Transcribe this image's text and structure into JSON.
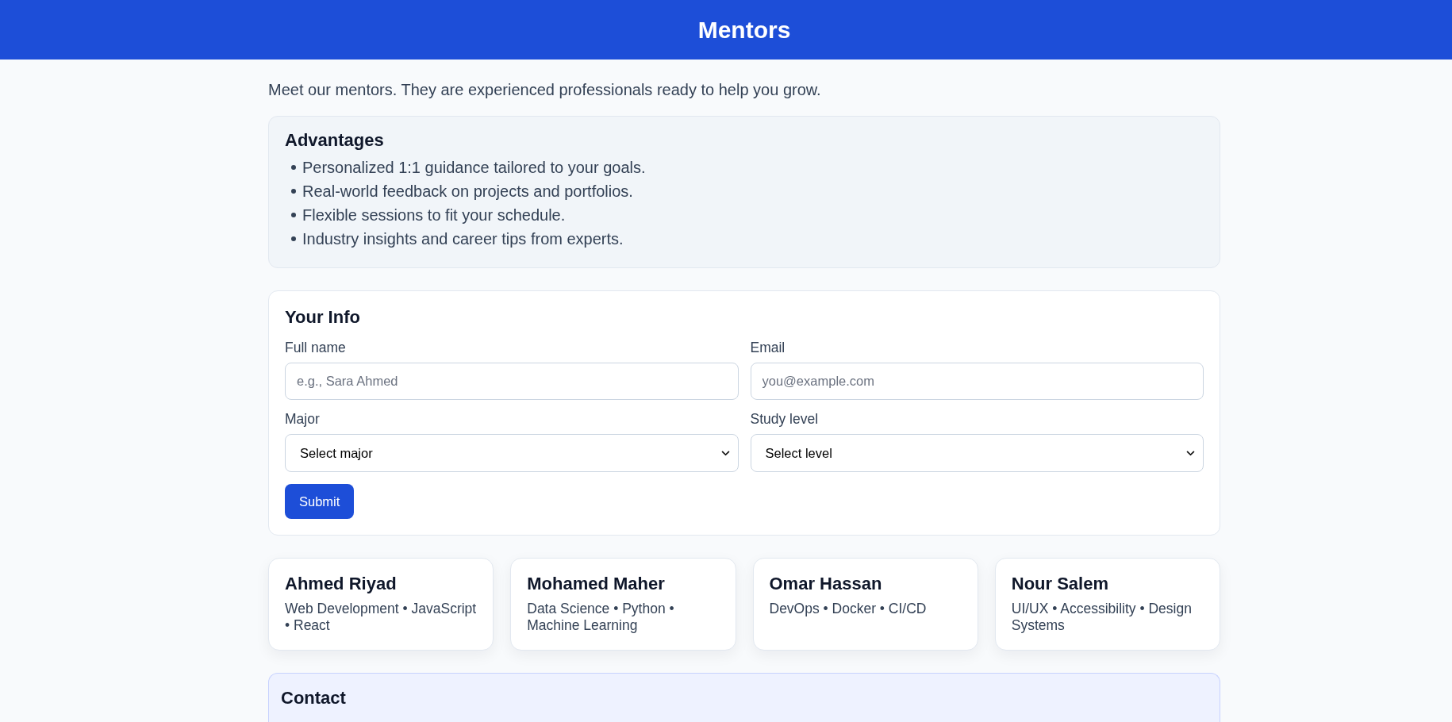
{
  "header": {
    "title": "Mentors"
  },
  "intro": "Meet our mentors. They are experienced professionals ready to help you grow.",
  "advantages": {
    "title": "Advantages",
    "items": [
      "Personalized 1:1 guidance tailored to your goals.",
      "Real-world feedback on projects and portfolios.",
      "Flexible sessions to fit your schedule.",
      "Industry insights and career tips from experts."
    ]
  },
  "form": {
    "title": "Your Info",
    "fields": [
      {
        "kind": "input",
        "label": "Full name",
        "placeholder": "e.g., Sara Ahmed"
      },
      {
        "kind": "input",
        "label": "Email",
        "placeholder": "you@example.com"
      },
      {
        "kind": "select",
        "label": "Major",
        "value": "Select major"
      },
      {
        "kind": "select",
        "label": "Study level",
        "value": "Select level"
      }
    ],
    "submit": "Submit"
  },
  "mentors": [
    {
      "name": "Ahmed Riyad",
      "tags": "Web Development • JavaScript • React"
    },
    {
      "name": "Mohamed Maher",
      "tags": "Data Science • Python • Machine Learning"
    },
    {
      "name": "Omar Hassan",
      "tags": "DevOps • Docker • CI/CD"
    },
    {
      "name": "Nour Salem",
      "tags": "UI/UX • Accessibility • Design Systems"
    }
  ],
  "contact": {
    "title": "Contact"
  }
}
